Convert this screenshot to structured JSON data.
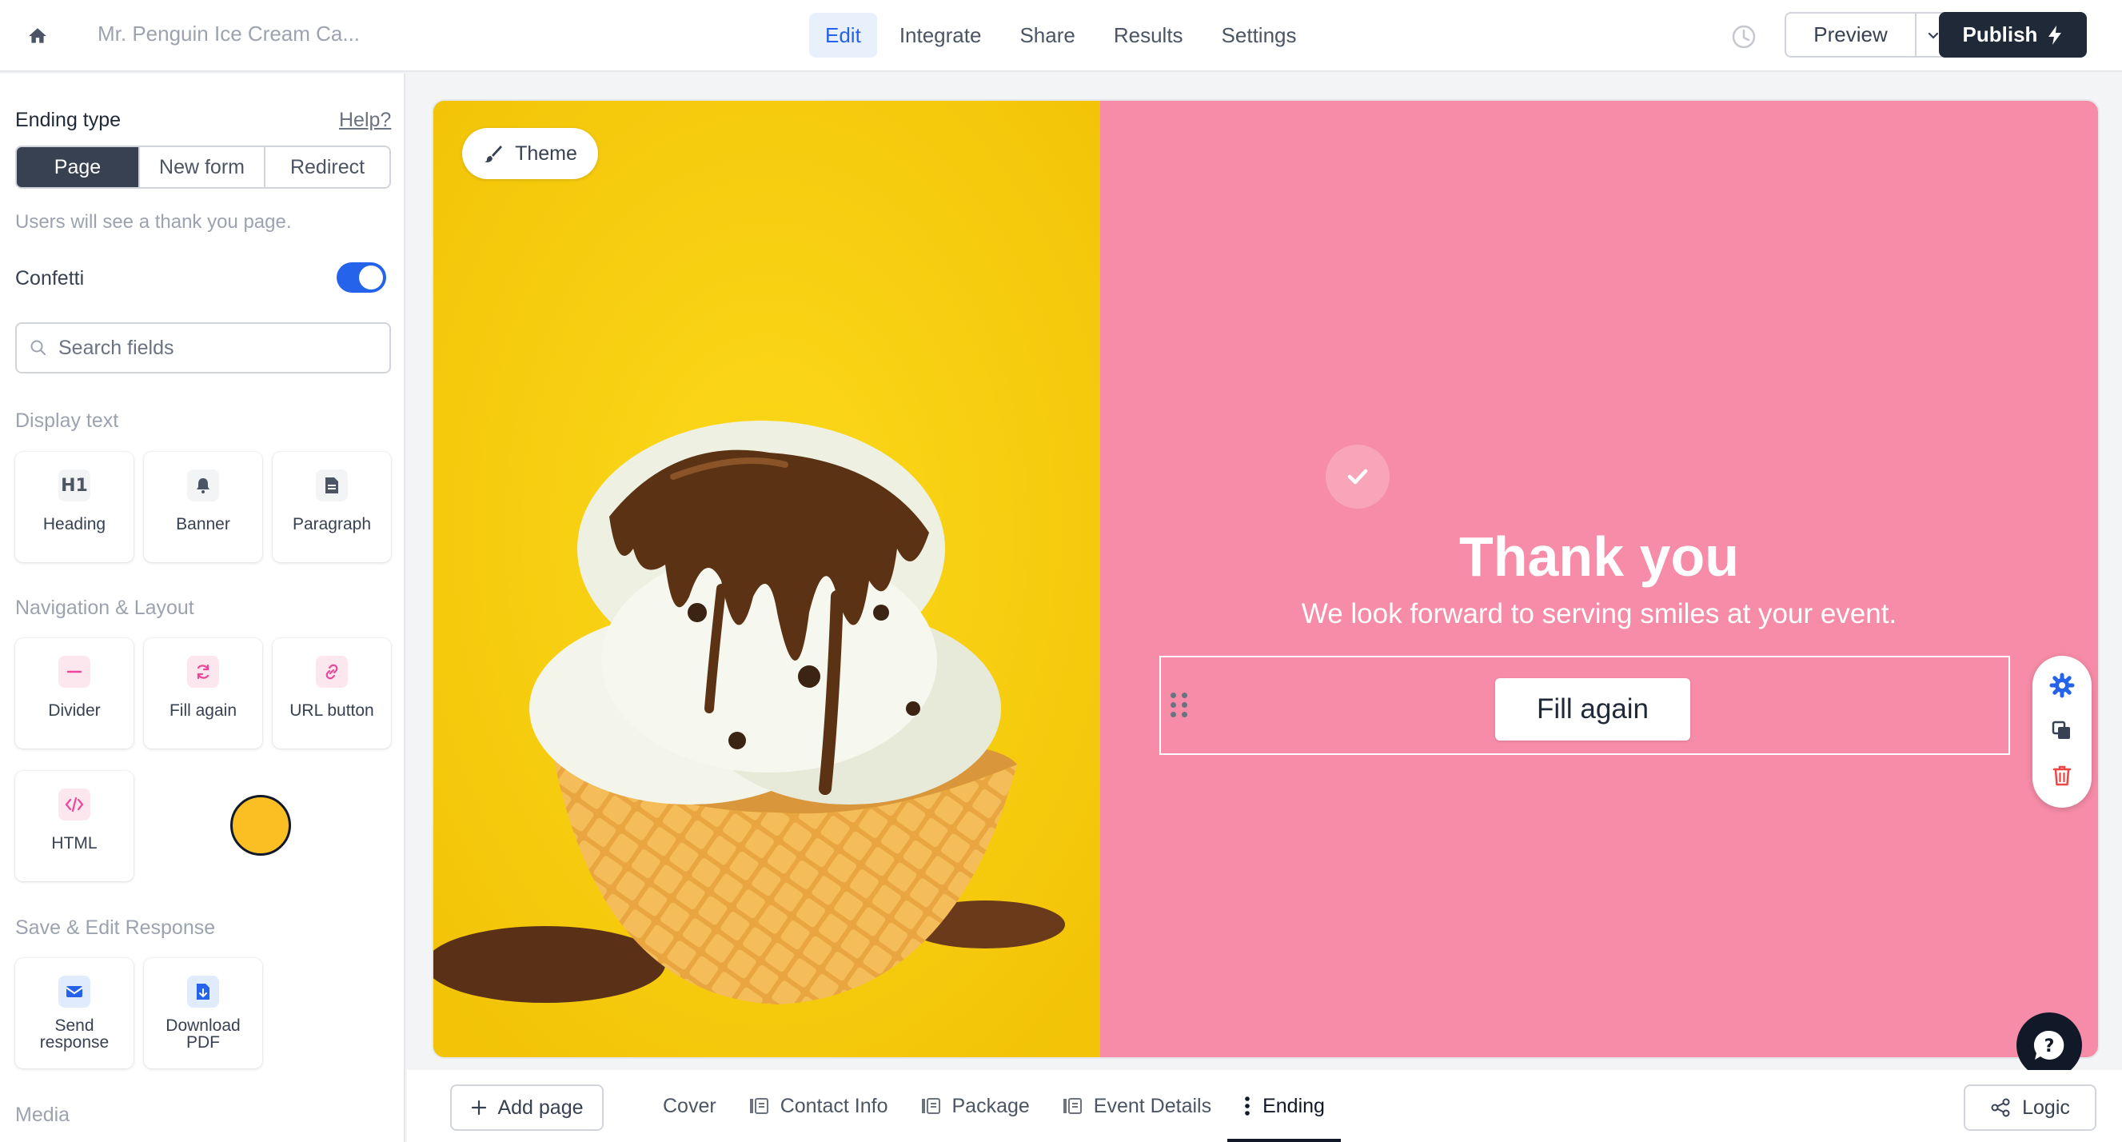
{
  "topbar": {
    "form_title": "Mr. Penguin Ice Cream Ca...",
    "nav": [
      {
        "label": "Edit",
        "active": true
      },
      {
        "label": "Integrate",
        "active": false
      },
      {
        "label": "Share",
        "active": false
      },
      {
        "label": "Results",
        "active": false
      },
      {
        "label": "Settings",
        "active": false
      }
    ],
    "preview_label": "Preview",
    "publish_label": "Publish"
  },
  "sidebar": {
    "ending_type_label": "Ending type",
    "help_label": "Help?",
    "ending_options": [
      "Page",
      "New form",
      "Redirect"
    ],
    "ending_selected": "Page",
    "ending_description": "Users will see a thank you page.",
    "confetti_label": "Confetti",
    "confetti_enabled": true,
    "search_placeholder": "Search fields",
    "sections": {
      "display_text": {
        "title": "Display text",
        "items": [
          {
            "label": "Heading",
            "icon": "heading-icon"
          },
          {
            "label": "Banner",
            "icon": "bell-icon"
          },
          {
            "label": "Paragraph",
            "icon": "document-icon"
          }
        ]
      },
      "navigation": {
        "title": "Navigation & Layout",
        "items": [
          {
            "label": "Divider",
            "icon": "divider-icon"
          },
          {
            "label": "Fill again",
            "icon": "refresh-icon"
          },
          {
            "label": "URL button",
            "icon": "link-icon"
          },
          {
            "label": "HTML",
            "icon": "code-icon"
          }
        ]
      },
      "save_edit": {
        "title": "Save & Edit Response",
        "items": [
          {
            "label_line1": "Send",
            "label_line2": "response",
            "icon": "mail-icon"
          },
          {
            "label_line1": "Download",
            "label_line2": "PDF",
            "icon": "download-icon"
          }
        ]
      },
      "media": {
        "title": "Media"
      }
    }
  },
  "canvas": {
    "theme_label": "Theme",
    "thank_you_title": "Thank you",
    "thank_you_subtitle": "We look forward to serving smiles at your event.",
    "fill_again_label": "Fill again",
    "left_bg_color": "#f5ce0a",
    "right_bg_color": "#f68ca7"
  },
  "bottombar": {
    "add_page_label": "Add page",
    "pages": [
      {
        "label": "Cover",
        "icon": null,
        "active": false
      },
      {
        "label": "Contact Info",
        "icon": "form-page-icon",
        "active": false
      },
      {
        "label": "Package",
        "icon": "form-page-icon",
        "active": false
      },
      {
        "label": "Event Details",
        "icon": "form-page-icon",
        "active": false
      },
      {
        "label": "Ending",
        "icon": "more-vertical-icon",
        "active": true
      }
    ],
    "logic_label": "Logic"
  },
  "colors": {
    "accent": "#2563eb",
    "dark": "#1f2937",
    "pink_icon": "#ec4899"
  }
}
